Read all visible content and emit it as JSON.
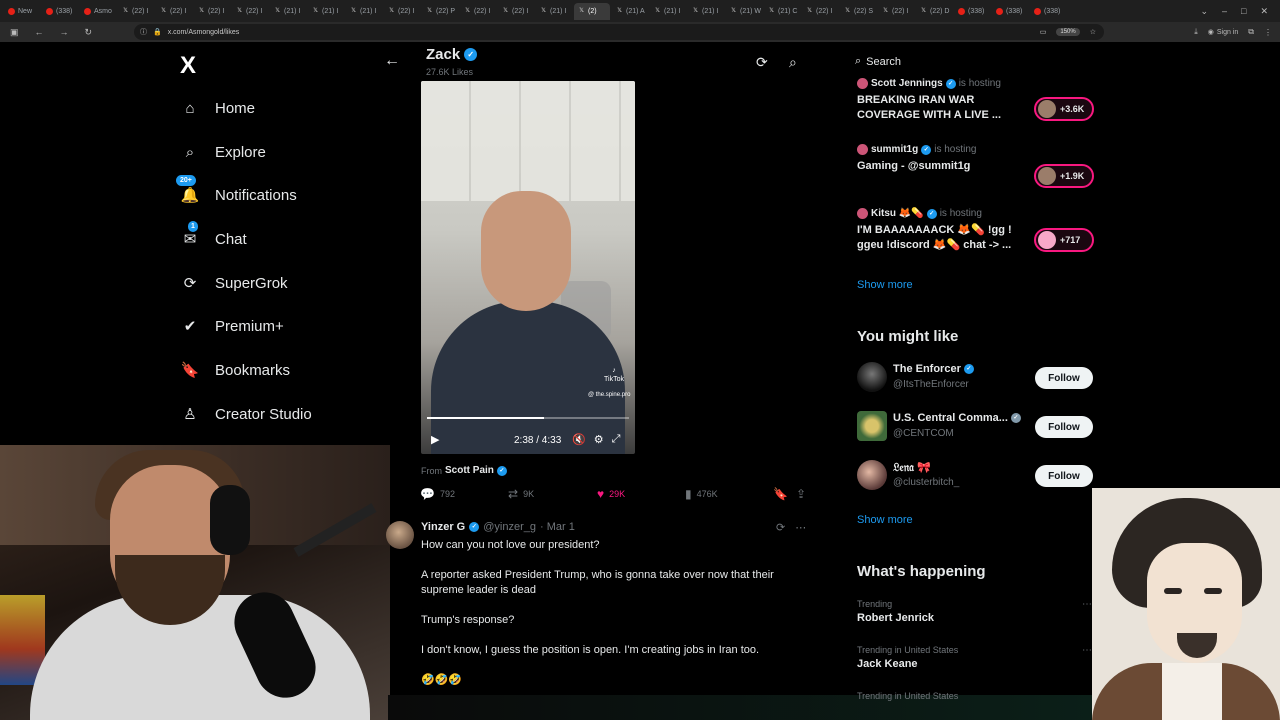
{
  "browser": {
    "tabs": [
      {
        "label": "New",
        "fav": "yt"
      },
      {
        "label": "(338)",
        "fav": "yt"
      },
      {
        "label": "Asmo",
        "fav": "yt"
      },
      {
        "label": "(22) I",
        "fav": "x"
      },
      {
        "label": "(22) I",
        "fav": "x"
      },
      {
        "label": "(22) I",
        "fav": "x"
      },
      {
        "label": "(22) I",
        "fav": "x"
      },
      {
        "label": "(21) I",
        "fav": "x"
      },
      {
        "label": "(21) I",
        "fav": "x"
      },
      {
        "label": "(21) I",
        "fav": "x"
      },
      {
        "label": "(22) I",
        "fav": "x"
      },
      {
        "label": "(22) P",
        "fav": "x"
      },
      {
        "label": "(22) I",
        "fav": "x"
      },
      {
        "label": "(22) I",
        "fav": "x"
      },
      {
        "label": "(21) I",
        "fav": "x"
      },
      {
        "label": "(2)",
        "fav": "x",
        "active": true
      },
      {
        "label": "(21) A",
        "fav": "x"
      },
      {
        "label": "(21) I",
        "fav": "x"
      },
      {
        "label": "(21) I",
        "fav": "x"
      },
      {
        "label": "(21) W",
        "fav": "x"
      },
      {
        "label": "(21) C",
        "fav": "x"
      },
      {
        "label": "(22) I",
        "fav": "x"
      },
      {
        "label": "(22) S",
        "fav": "x"
      },
      {
        "label": "(22) I",
        "fav": "x"
      },
      {
        "label": "(22) D",
        "fav": "x"
      },
      {
        "label": "(338)",
        "fav": "yt"
      },
      {
        "label": "(338)",
        "fav": "yt"
      },
      {
        "label": "(338)",
        "fav": "yt"
      }
    ],
    "url": "x.com/Asmongold/likes",
    "zoom": "150%",
    "signin": "Sign in"
  },
  "nav": {
    "logo": "X",
    "items": [
      {
        "label": "Home",
        "icon": "home-icon"
      },
      {
        "label": "Explore",
        "icon": "search-icon"
      },
      {
        "label": "Notifications",
        "icon": "bell-icon",
        "badge": "20+"
      },
      {
        "label": "Chat",
        "icon": "mail-icon",
        "badge": "1"
      },
      {
        "label": "SuperGrok",
        "icon": "grok-icon"
      },
      {
        "label": "Premium+",
        "icon": "verified-badge-icon"
      },
      {
        "label": "Bookmarks",
        "icon": "bookmark-icon"
      },
      {
        "label": "Creator Studio",
        "icon": "creator-icon"
      }
    ]
  },
  "profile": {
    "name": "Zack",
    "likes": "27.6K Likes"
  },
  "video": {
    "time": "2:38 / 4:33",
    "progress": 0.58,
    "tiktok_label": "TikTok",
    "tiktok_handle": "@ the.spine.pro",
    "from_prefix": "From",
    "from_name": "Scott Pain"
  },
  "post_actions": {
    "replies": "792",
    "reposts": "9K",
    "likes": "29K",
    "views": "476K"
  },
  "tweet": {
    "name": "Yinzer G",
    "handle": "@yinzer_g",
    "date": "· Mar 1",
    "lines": [
      "How can you not love our president?",
      "A reporter asked President Trump, who is gonna take over now that their supreme leader is dead",
      "Trump's response?",
      "I don't know, I guess the position is open. I'm creating jobs in Iran too.",
      "🤣🤣🤣"
    ]
  },
  "right": {
    "search_placeholder": "Search",
    "spaces": [
      {
        "host": "Scott Jennings",
        "status": "is hosting",
        "title": "BREAKING IRAN WAR COVERAGE WITH A LIVE ...",
        "listeners": "+3.6K"
      },
      {
        "host": "summit1g",
        "status": "is hosting",
        "title": "Gaming - @summit1g",
        "listeners": "+1.9K"
      },
      {
        "host": "Kitsu 🦊💊",
        "status": "is hosting",
        "title": "I'M BAAAAAAACK 🦊💊 !gg ! ggeu !discord 🦊💊 chat -> ...",
        "listeners": "+717"
      }
    ],
    "show_more": "Show more",
    "you_might_like_title": "You might like",
    "suggestions": [
      {
        "name": "The Enforcer",
        "handle": "@ItsTheEnforcer",
        "follow": "Follow"
      },
      {
        "name": "U.S. Central Comma...",
        "handle": "@CENTCOM",
        "follow": "Follow"
      },
      {
        "name": "𝔏𝔢𝔫𝔞 🎀",
        "handle": "@clusterbitch_",
        "follow": "Follow"
      }
    ],
    "show_more_2": "Show more",
    "whats_happening_title": "What's happening",
    "trends": [
      {
        "context": "Trending",
        "name": "Robert Jenrick"
      },
      {
        "context": "Trending in United States",
        "name": "Jack Keane"
      },
      {
        "context": "Trending in United States",
        "name": ""
      }
    ]
  }
}
